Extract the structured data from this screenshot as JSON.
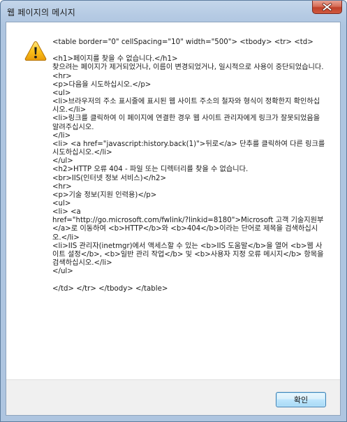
{
  "window": {
    "title": "웹 페이지의 메시지"
  },
  "dialog": {
    "icon": "warning-icon",
    "message": "<table border=\"0\" cellSpacing=\"10\" width=\"500\"> <tbody> <tr> <td>\n\n<h1>페이지를 찾을 수 없습니다.</h1>\n찾으려는 페이지가 제거되었거나, 이름이 변경되었거나, 일시적으로 사용이 중단되었습니다.\n<hr>\n<p>다음을 시도하십시오.</p>\n<ul>\n<li>브라우저의 주소 표시줄에 표시된 웹 사이트 주소의 철자와 형식이 정확한지 확인하십시오.</li>\n<li>링크를 클릭하여 이 페이지에 연결한 경우 웹 사이트 관리자에게 링크가 잘못되었음을 알려주십시오.\n</li>\n<li> <a href=\"javascript:history.back(1)\">뒤로</a> 단추를 클릭하여 다른 링크를 시도하십시오.</li>\n</ul>\n<h2>HTTP 오류 404 - 파일 또는 디렉터리를 찾을 수 없습니다.\n<br>IIS(인터넷 정보 서비스)</h2>\n<hr>\n<p>기술 정보(지원 인력용)</p>\n<ul>\n<li> <a\nhref=\"http://go.microsoft.com/fwlink/?linkid=8180\">Microsoft 고객 기술지원부</a>로 이동하여 <b>HTTP</b>와 <b>404</b>이라는 단어로 제목을 검색하십시오.</li>\n<li>IIS 관리자(inetmgr)에서 액세스할 수 있는 <b>IIS 도움말</b>을 열어 <b>웹 사이트 설정</b>, <b>일반 관리 작업</b> 및 <b>사용자 지정 오류 메시지</b> 항목을 검색하십시오.</li>\n</ul>\n\n</td> </tr> </tbody> </table>"
  },
  "buttons": {
    "ok_label": "확인",
    "close_icon": "close-icon"
  }
}
